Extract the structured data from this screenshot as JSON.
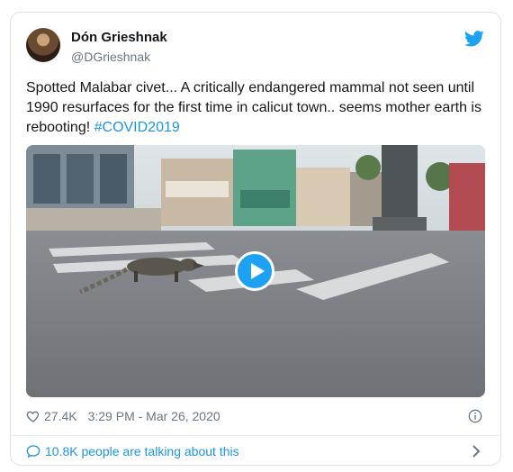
{
  "author": {
    "name": "Dón Grieshnak",
    "handle": "@DGrieshnak"
  },
  "tweet": {
    "text": "Spotted Malabar civet... A critically endangered mammal not seen until 1990 resurfaces for the first time in calicut town.. seems mother earth is rebooting! ",
    "hashtag": "#COVID2019"
  },
  "stats": {
    "likes": "27.4K",
    "timestamp": "3:29 PM - Mar 26, 2020"
  },
  "conversation": {
    "label": "10.8K people are talking about this"
  },
  "icons": {
    "brand": "twitter-bird-icon",
    "like": "heart-icon",
    "info": "info-icon",
    "conversation": "speech-bubble-icon",
    "more": "chevron-right-icon",
    "play": "play-icon"
  },
  "colors": {
    "accent": "#1da1f2",
    "link": "#1b95e0",
    "muted": "#657786",
    "border": "#dbe2e8"
  }
}
